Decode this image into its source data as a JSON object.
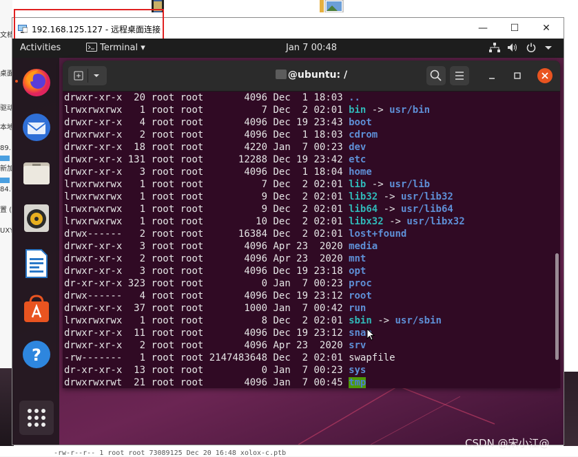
{
  "host": {
    "left_labels": [
      "文档",
      "桌面",
      "驱动",
      "本地",
      "89.",
      "新加",
      "84.",
      "置 (",
      "UXY"
    ],
    "bottom_text": "-rw-r--r-- 1 root root 73089125 Dec 20 16:48 xolox-c.ptb",
    "watermark": "CSDN @宋小江@"
  },
  "rdp": {
    "title": "192.168.125.127 - 远程桌面连接",
    "minimize": "—",
    "maximize": "☐",
    "close": "✕",
    "highlight_color": "#e02020"
  },
  "gnome": {
    "activities": "Activities",
    "app_menu": "Terminal",
    "app_menu_arrow": "▾",
    "clock": "Jan 7  00:48",
    "tray_icons": [
      "network-icon",
      "volume-icon",
      "power-icon",
      "chevron-down-icon"
    ]
  },
  "dock": {
    "items": [
      "firefox-icon",
      "thunderbird-icon",
      "files-icon",
      "rhythmbox-icon",
      "libreoffice-writer-icon",
      "software-center-icon",
      "help-icon",
      "show-apps-icon"
    ]
  },
  "terminal": {
    "title_suffix": "@ubuntu: /",
    "bg": "#300a24",
    "rows": [
      {
        "perm": "drwxr-xr-x ",
        "links": " 20",
        "owner": " root root",
        "size": "       4096",
        "month": " Dec",
        "day": "  1",
        "time": " 18:03",
        "name": "..",
        "target": "",
        "kind": "dir"
      },
      {
        "perm": "lrwxrwxrwx ",
        "links": "  1",
        "owner": " root root",
        "size": "          7",
        "month": " Dec",
        "day": "  2",
        "time": " 02:01",
        "name": "bin",
        "target": "usr/bin",
        "kind": "link"
      },
      {
        "perm": "drwxr-xr-x ",
        "links": "  4",
        "owner": " root root",
        "size": "       4096",
        "month": " Dec",
        "day": " 19",
        "time": " 23:43",
        "name": "boot",
        "target": "",
        "kind": "dir"
      },
      {
        "perm": "drwxrwxr-x ",
        "links": "  2",
        "owner": " root root",
        "size": "       4096",
        "month": " Dec",
        "day": "  1",
        "time": " 18:03",
        "name": "cdrom",
        "target": "",
        "kind": "dir"
      },
      {
        "perm": "drwxr-xr-x ",
        "links": " 18",
        "owner": " root root",
        "size": "       4220",
        "month": " Jan",
        "day": "  7",
        "time": " 00:23",
        "name": "dev",
        "target": "",
        "kind": "dir"
      },
      {
        "perm": "drwxr-xr-x ",
        "links": "131",
        "owner": " root root",
        "size": "      12288",
        "month": " Dec",
        "day": " 19",
        "time": " 23:42",
        "name": "etc",
        "target": "",
        "kind": "dir"
      },
      {
        "perm": "drwxr-xr-x ",
        "links": "  3",
        "owner": " root root",
        "size": "       4096",
        "month": " Dec",
        "day": "  1",
        "time": " 18:04",
        "name": "home",
        "target": "",
        "kind": "dir"
      },
      {
        "perm": "lrwxrwxrwx ",
        "links": "  1",
        "owner": " root root",
        "size": "          7",
        "month": " Dec",
        "day": "  2",
        "time": " 02:01",
        "name": "lib",
        "target": "usr/lib",
        "kind": "link"
      },
      {
        "perm": "lrwxrwxrwx ",
        "links": "  1",
        "owner": " root root",
        "size": "          9",
        "month": " Dec",
        "day": "  2",
        "time": " 02:01",
        "name": "lib32",
        "target": "usr/lib32",
        "kind": "link"
      },
      {
        "perm": "lrwxrwxrwx ",
        "links": "  1",
        "owner": " root root",
        "size": "          9",
        "month": " Dec",
        "day": "  2",
        "time": " 02:01",
        "name": "lib64",
        "target": "usr/lib64",
        "kind": "link"
      },
      {
        "perm": "lrwxrwxrwx ",
        "links": "  1",
        "owner": " root root",
        "size": "         10",
        "month": " Dec",
        "day": "  2",
        "time": " 02:01",
        "name": "libx32",
        "target": "usr/libx32",
        "kind": "link"
      },
      {
        "perm": "drwx------ ",
        "links": "  2",
        "owner": " root root",
        "size": "      16384",
        "month": " Dec",
        "day": "  2",
        "time": " 02:01",
        "name": "lost+found",
        "target": "",
        "kind": "dir"
      },
      {
        "perm": "drwxr-xr-x ",
        "links": "  3",
        "owner": " root root",
        "size": "       4096",
        "month": " Apr",
        "day": " 23",
        "time": "  2020",
        "name": "media",
        "target": "",
        "kind": "dir"
      },
      {
        "perm": "drwxr-xr-x ",
        "links": "  2",
        "owner": " root root",
        "size": "       4096",
        "month": " Apr",
        "day": " 23",
        "time": "  2020",
        "name": "mnt",
        "target": "",
        "kind": "dir"
      },
      {
        "perm": "drwxr-xr-x ",
        "links": "  3",
        "owner": " root root",
        "size": "       4096",
        "month": " Dec",
        "day": " 19",
        "time": " 23:18",
        "name": "opt",
        "target": "",
        "kind": "dir"
      },
      {
        "perm": "dr-xr-xr-x ",
        "links": "323",
        "owner": " root root",
        "size": "          0",
        "month": " Jan",
        "day": "  7",
        "time": " 00:23",
        "name": "proc",
        "target": "",
        "kind": "dir"
      },
      {
        "perm": "drwx------ ",
        "links": "  4",
        "owner": " root root",
        "size": "       4096",
        "month": " Dec",
        "day": " 19",
        "time": " 23:12",
        "name": "root",
        "target": "",
        "kind": "dir"
      },
      {
        "perm": "drwxr-xr-x ",
        "links": " 37",
        "owner": " root root",
        "size": "       1000",
        "month": " Jan",
        "day": "  7",
        "time": " 00:42",
        "name": "run",
        "target": "",
        "kind": "dir"
      },
      {
        "perm": "lrwxrwxrwx ",
        "links": "  1",
        "owner": " root root",
        "size": "          8",
        "month": " Dec",
        "day": "  2",
        "time": " 02:01",
        "name": "sbin",
        "target": "usr/sbin",
        "kind": "link"
      },
      {
        "perm": "drwxr-xr-x ",
        "links": " 11",
        "owner": " root root",
        "size": "       4096",
        "month": " Dec",
        "day": " 19",
        "time": " 23:12",
        "name": "snap",
        "target": "",
        "kind": "dir"
      },
      {
        "perm": "drwxr-xr-x ",
        "links": "  2",
        "owner": " root root",
        "size": "       4096",
        "month": " Apr",
        "day": " 23",
        "time": "  2020",
        "name": "srv",
        "target": "",
        "kind": "dir"
      },
      {
        "perm": "-rw------- ",
        "links": "  1",
        "owner": " root root",
        "size": " 2147483648",
        "month": " Dec",
        "day": "  2",
        "time": " 02:01",
        "name": "swapfile",
        "target": "",
        "kind": "file"
      },
      {
        "perm": "dr-xr-xr-x ",
        "links": " 13",
        "owner": " root root",
        "size": "          0",
        "month": " Jan",
        "day": "  7",
        "time": " 00:23",
        "name": "sys",
        "target": "",
        "kind": "dir"
      },
      {
        "perm": "drwxrwxrwt ",
        "links": " 21",
        "owner": " root root",
        "size": "       4096",
        "month": " Jan",
        "day": "  7",
        "time": " 00:45",
        "name": "tmp",
        "target": "",
        "kind": "tmp"
      }
    ]
  }
}
